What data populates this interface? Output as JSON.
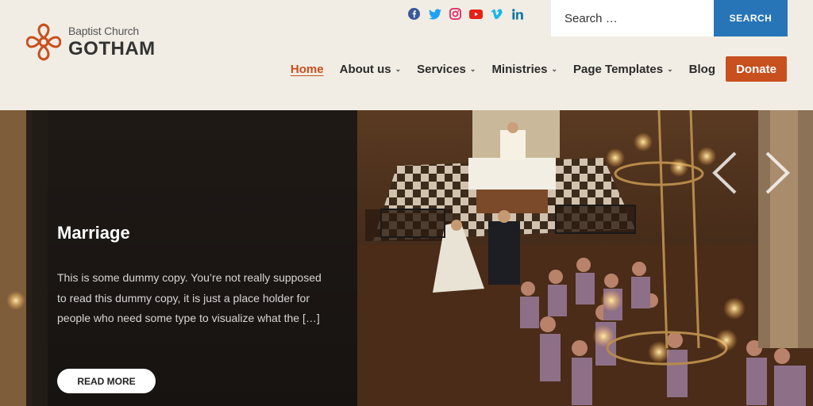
{
  "logo": {
    "subtitle": "Baptist Church",
    "title": "GOTHAM",
    "icon": "cross-flower-icon",
    "color": "#c8501e"
  },
  "social": [
    {
      "name": "facebook-icon",
      "color": "#3b5998"
    },
    {
      "name": "twitter-icon",
      "color": "#1da1f2"
    },
    {
      "name": "instagram-icon",
      "color": "#e1306c"
    },
    {
      "name": "youtube-icon",
      "color": "#e62117"
    },
    {
      "name": "vimeo-icon",
      "color": "#1ab7ea"
    },
    {
      "name": "linkedin-icon",
      "color": "#0e76a8"
    }
  ],
  "search": {
    "placeholder": "Search …",
    "button_label": "SEARCH"
  },
  "nav": {
    "home": "Home",
    "about": "About us",
    "services": "Services",
    "ministries": "Ministries",
    "templates": "Page Templates",
    "blog": "Blog",
    "donate": "Donate"
  },
  "hero": {
    "title": "Marriage",
    "text": "This is some dummy copy. You’re not really supposed to read this dummy copy, it is just a place holder for people who need some type to visualize what the […]",
    "button": "READ MORE"
  },
  "colors": {
    "accent": "#c8501e",
    "search": "#2775b6",
    "background": "#f1ede4"
  }
}
